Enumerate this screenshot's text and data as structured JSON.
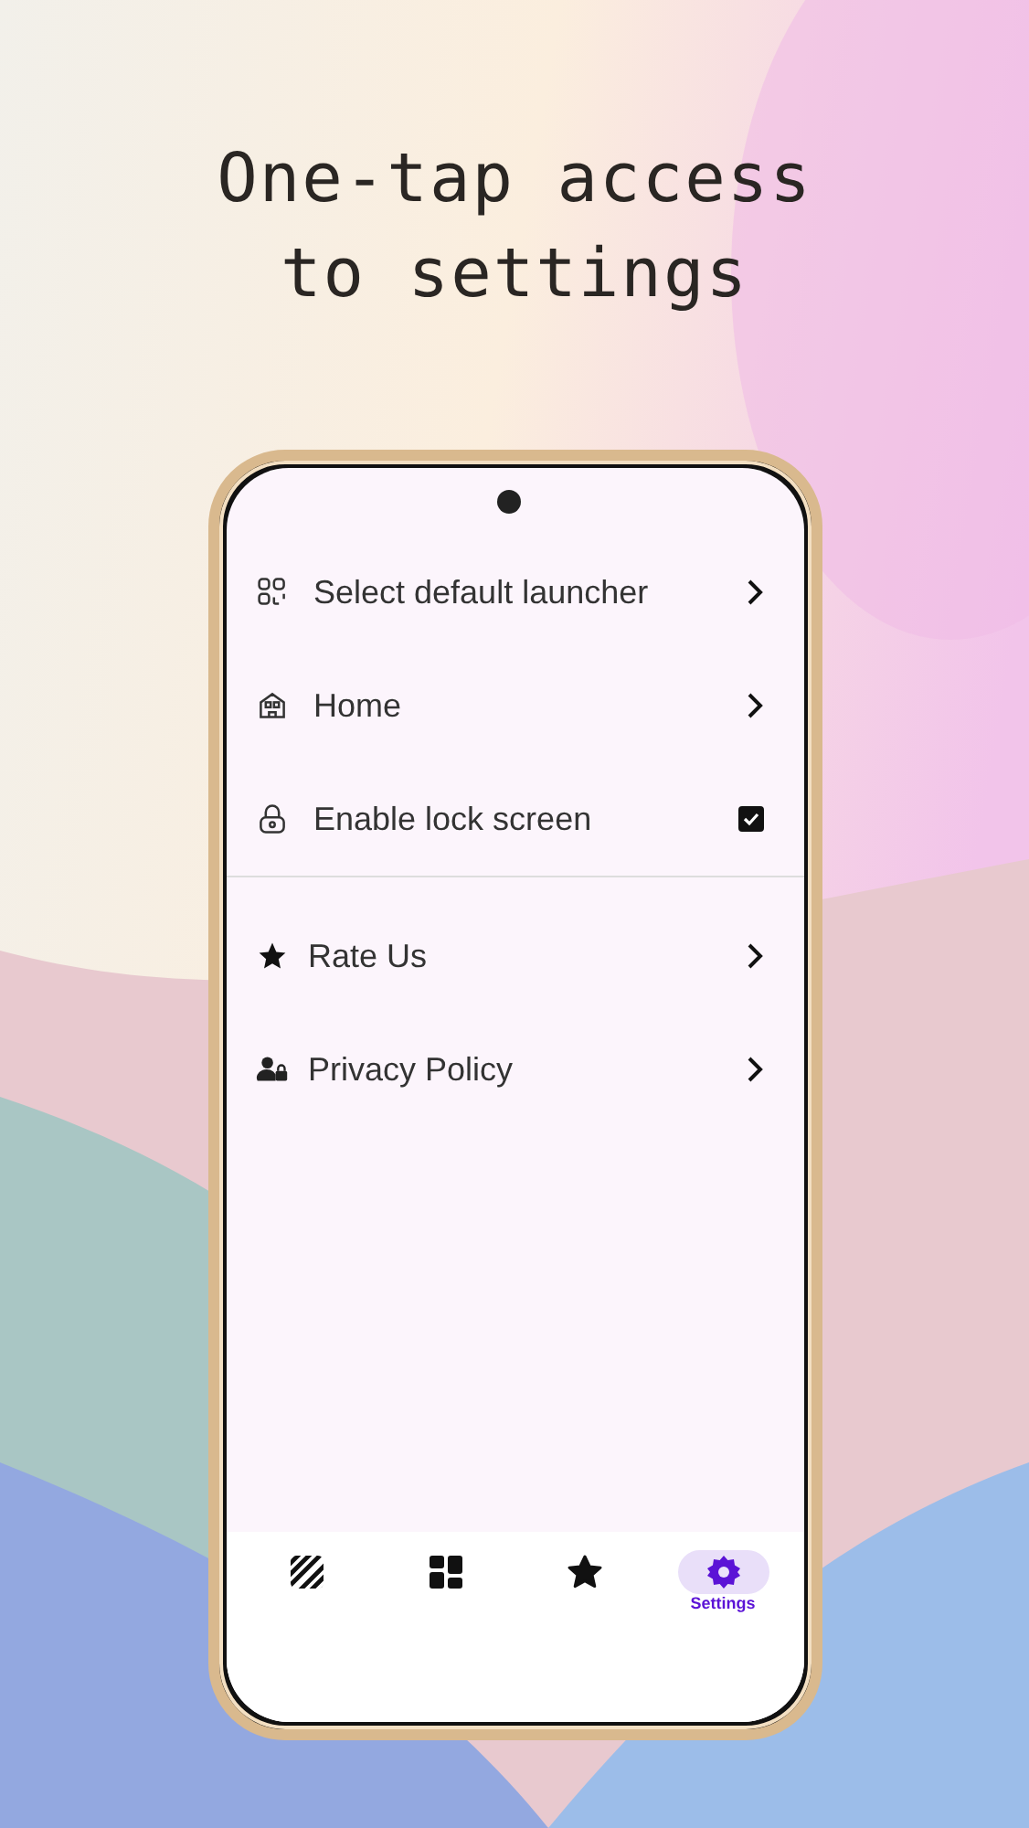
{
  "headline": [
    "One-tap access",
    "to settings"
  ],
  "sections": [
    {
      "items": [
        {
          "kind": "link",
          "label": "Select default launcher"
        },
        {
          "kind": "link",
          "label": "Home"
        },
        {
          "kind": "checkbox",
          "label": "Enable lock screen",
          "checked": true
        }
      ]
    },
    {
      "items": [
        {
          "kind": "link",
          "label": "Rate Us"
        },
        {
          "kind": "link",
          "label": "Privacy Policy"
        }
      ]
    }
  ],
  "nav": [
    {
      "selected": false
    },
    {
      "selected": false
    },
    {
      "selected": false
    },
    {
      "selected": true,
      "label": "Settings"
    }
  ]
}
